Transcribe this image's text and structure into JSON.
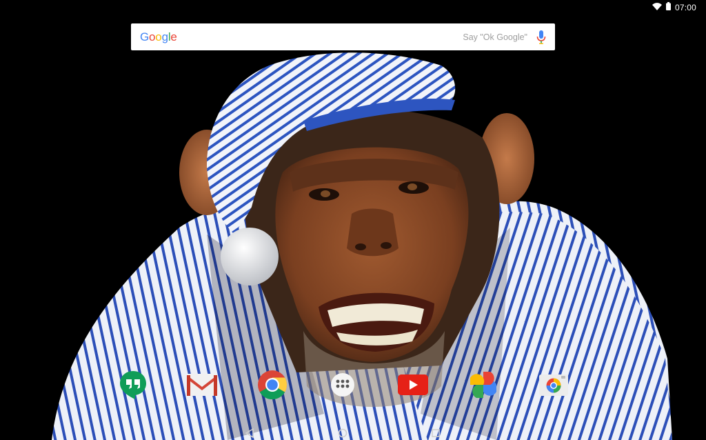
{
  "wallpaper": {
    "icon": "chimpanzee-wallpaper",
    "colors": {
      "background": "#000000",
      "skin": "#8a4a26",
      "fur": "#3b2619",
      "stripe": "#2c4fb8",
      "fabric": "#f2f4fa"
    }
  },
  "status_bar": {
    "time": "07:00",
    "icons": [
      "wifi-icon",
      "battery-icon"
    ]
  },
  "search_bar": {
    "logo_letters": [
      "G",
      "o",
      "o",
      "g",
      "l",
      "e"
    ],
    "logo_colors": [
      "#4285F4",
      "#EA4335",
      "#FBBC05",
      "#4285F4",
      "#34A853",
      "#EA4335"
    ],
    "hint": "Say \"Ok Google\"",
    "mic_icon": "microphone-icon"
  },
  "dock": {
    "apps": [
      {
        "icon": "hangouts-icon",
        "color": "#0f9d58"
      },
      {
        "icon": "gmail-icon",
        "color": "#d44638"
      },
      {
        "icon": "chrome-icon",
        "color": "#4285F4"
      },
      {
        "icon": "app-drawer-icon",
        "color": "#ffffff"
      },
      {
        "icon": "youtube-icon",
        "color": "#e62117"
      },
      {
        "icon": "google-photos-icon",
        "color": "#fbbc05"
      },
      {
        "icon": "camera-icon",
        "color": "#ececec"
      }
    ]
  },
  "nav_bar": {
    "buttons": [
      "back-icon",
      "home-icon",
      "recents-icon"
    ]
  }
}
